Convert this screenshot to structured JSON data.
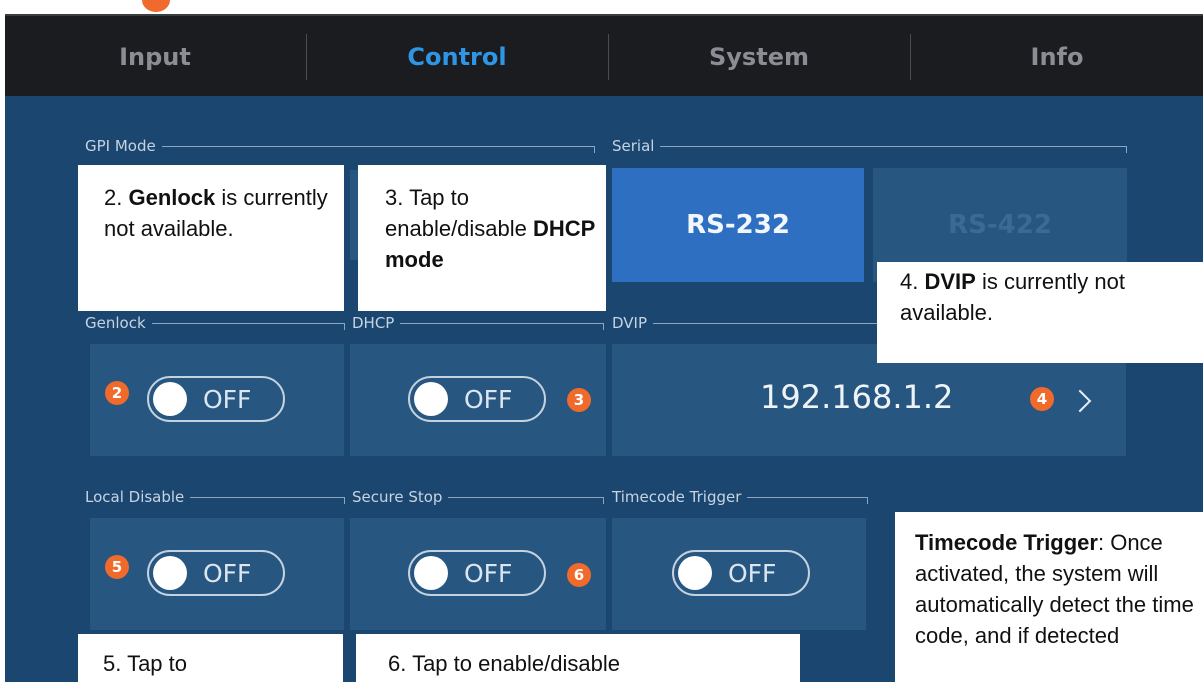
{
  "tabs": [
    {
      "label": "Input"
    },
    {
      "label": "Control"
    },
    {
      "label": "System"
    },
    {
      "label": "Info"
    }
  ],
  "groups": {
    "gpi_mode": "GPI Mode",
    "serial": "Serial",
    "genlock": "Genlock",
    "dhcp": "DHCP",
    "dvip": "DVIP",
    "local_disable": "Local Disable",
    "secure_stop": "Secure Stop",
    "timecode_trigger": "Timecode Trigger"
  },
  "serial": {
    "rs232": "RS-232",
    "rs422": "RS-422",
    "selected": "RS-232"
  },
  "toggles": {
    "genlock": "OFF",
    "dhcp": "OFF",
    "local_disable": "OFF",
    "secure_stop": "OFF",
    "timecode_trigger": "OFF"
  },
  "dvip": {
    "ip": "192.168.1.2"
  },
  "badges": {
    "b2": "2",
    "b3": "3",
    "b4": "4",
    "b5": "5",
    "b6": "6"
  },
  "callouts": {
    "c2": {
      "pre": "2. ",
      "bold": "Genlock",
      "post": " is currently not available."
    },
    "c3": {
      "pre": "3. Tap to enable/disable ",
      "bold": "DHCP mode",
      "post": ""
    },
    "c4": {
      "pre": "4. ",
      "bold": "DVIP",
      "post": " is currently not available."
    },
    "c5": {
      "pre": "5. Tap to",
      "bold": "",
      "post": ""
    },
    "c6": {
      "pre": "6. Tap to enable/disable",
      "bold": "",
      "post": ""
    },
    "ctc": {
      "pre": "",
      "bold": "Timecode Trigger",
      "post": ": Once activated, the system will automatically detect the time code, and if detected"
    }
  },
  "colors": {
    "accent": "#2f96e6",
    "panel": "#1a4670",
    "cell": "#275680",
    "badge": "#f06a2b",
    "selected_button": "#2f6fc2"
  }
}
